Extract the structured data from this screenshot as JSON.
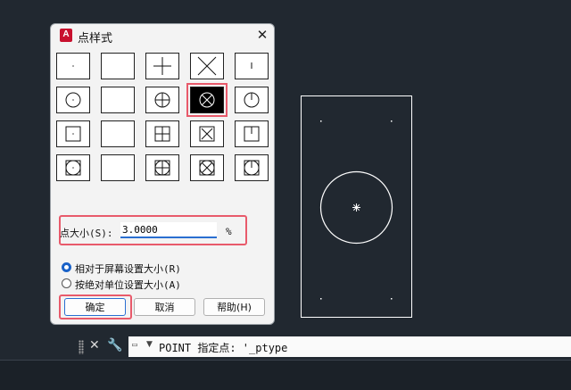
{
  "dialog": {
    "title": "点样式",
    "app_icon_letter": "A",
    "close_glyph": "✕",
    "selected_style": "circle-x",
    "styles": [
      "dot",
      "none",
      "plus",
      "x",
      "tick",
      "circle-dot",
      "circle",
      "circle-plus",
      "circle-x",
      "circle-tick",
      "square-dot",
      "square",
      "square-plus",
      "square-x",
      "square-tick",
      "sqcircle-dot",
      "sqcircle",
      "sqcircle-plus",
      "sqcircle-x",
      "sqcircle-tick"
    ],
    "size_label": "点大小(S):",
    "size_value": "3.0000",
    "size_unit": "%",
    "radio_relative": "相对于屏幕设置大小(R)",
    "radio_absolute": "按绝对单位设置大小(A)",
    "radio_selected": "relative",
    "ok_label": "确定",
    "cancel_label": "取消",
    "help_label": "帮助(H)"
  },
  "command_line": {
    "prompt_icon": "▭",
    "arrow": "▼",
    "text": "POINT 指定点: '_ptype"
  },
  "colors": {
    "canvas_bg": "#212830",
    "highlight": "#e85a6b",
    "accent": "#2a6fd1",
    "entity": "#ffffff"
  }
}
